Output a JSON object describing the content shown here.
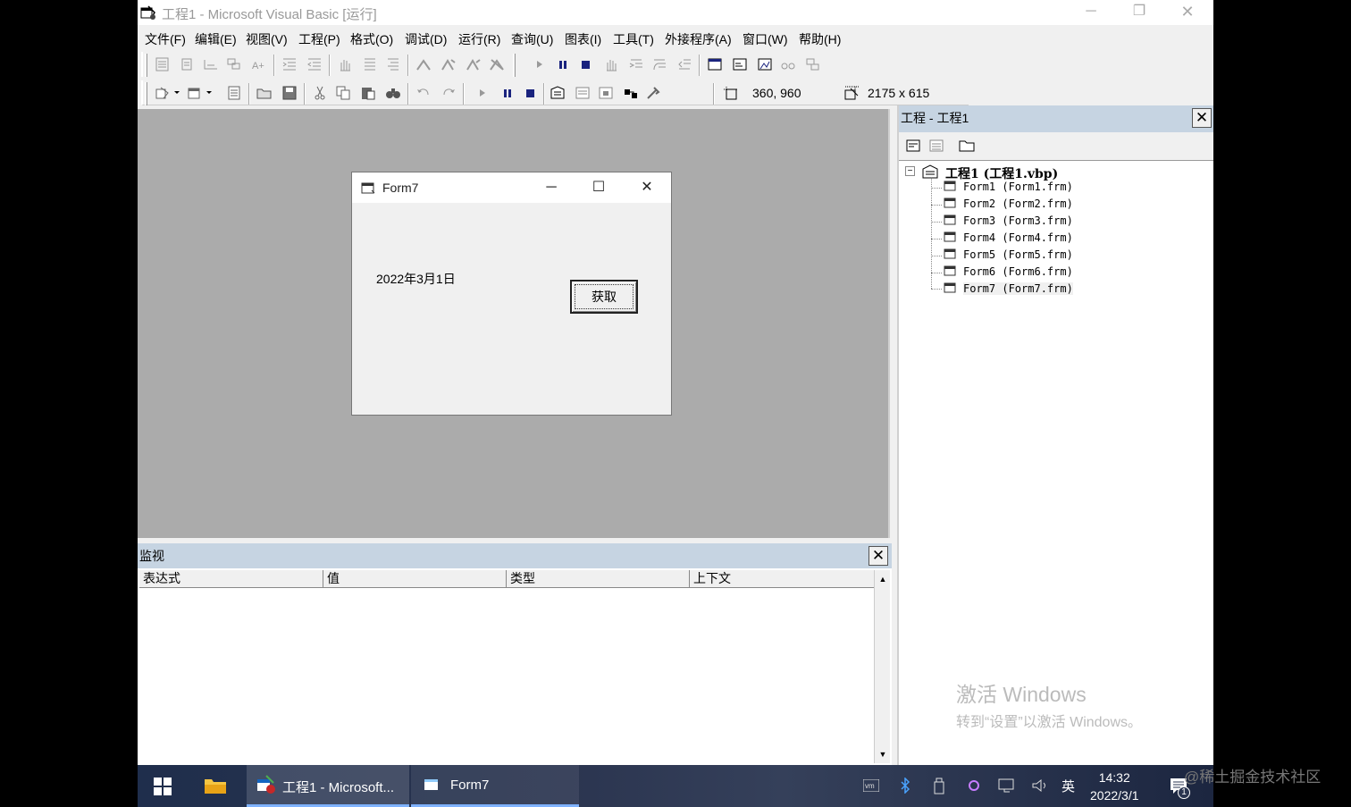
{
  "window": {
    "title": "工程1 - Microsoft Visual Basic [运行]",
    "minimize": "─",
    "restore": "❐",
    "close": "✕"
  },
  "menu": [
    "文件(F)",
    "编辑(E)",
    "视图(V)",
    "工程(P)",
    "格式(O)",
    "调试(D)",
    "运行(R)",
    "查询(U)",
    "图表(I)",
    "工具(T)",
    "外接程序(A)",
    "窗口(W)",
    "帮助(H)"
  ],
  "toolbar": {
    "position": "360, 960",
    "size": "2175 x 615"
  },
  "form7": {
    "title": "Form7",
    "minimize": "─",
    "maximize": "☐",
    "close": "✕",
    "date_label": "2022年3月1日",
    "button_label": "获取"
  },
  "watch": {
    "title": "监视",
    "columns": [
      "表达式",
      "值",
      "类型",
      "上下文"
    ]
  },
  "project": {
    "title": "工程 - 工程1",
    "root": "工程1 (工程1.vbp)",
    "items": [
      "Form1 (Form1.frm)",
      "Form2 (Form2.frm)",
      "Form3 (Form3.frm)",
      "Form4 (Form4.frm)",
      "Form5 (Form5.frm)",
      "Form6 (Form6.frm)",
      "Form7 (Form7.frm)"
    ],
    "activation_line1": "激活 Windows",
    "activation_line2": "转到“设置”以激活 Windows。"
  },
  "taskbar": {
    "tasks": [
      "工程1 - Microsoft...",
      "Form7"
    ],
    "ime": "英",
    "time": "14:32",
    "date": "2022/3/1",
    "notification_count": "1"
  },
  "overlay_watermark": "@稀土掘金技术社区",
  "colors": {
    "panel_title": "#c6d4e2",
    "mdi_background": "#ababab",
    "taskbar": "#2b3550"
  }
}
